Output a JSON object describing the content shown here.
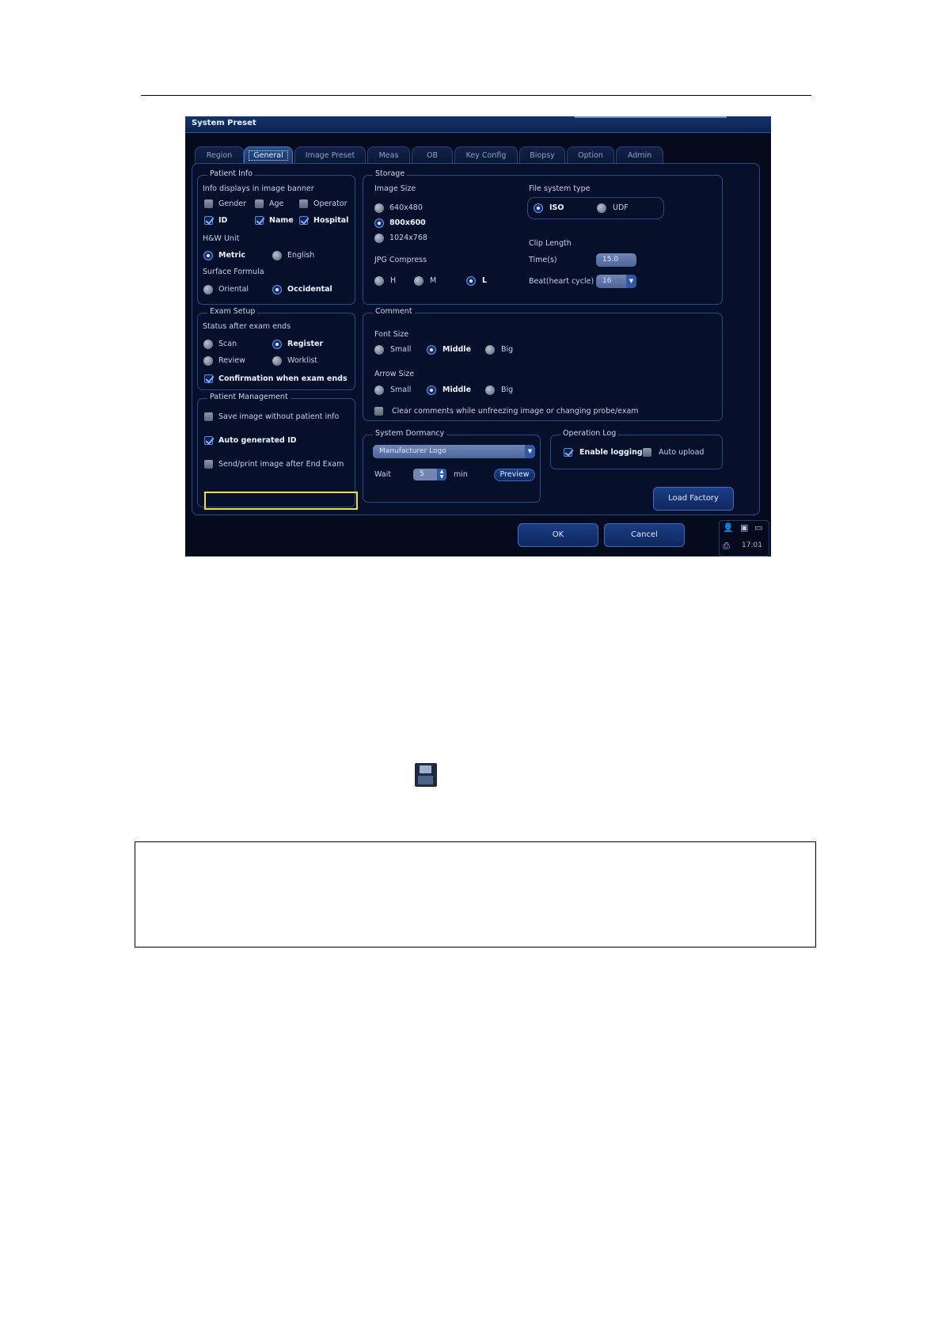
{
  "window": {
    "title": "System Preset"
  },
  "tabs": [
    "Region",
    "General",
    "Image Preset",
    "Meas",
    "OB",
    "Key Config",
    "Biopsy",
    "Option",
    "Admin"
  ],
  "active_tab": "General",
  "patient_info": {
    "legend": "Patient Info",
    "banner_label": "Info displays in image banner",
    "gender": "Gender",
    "age": "Age",
    "operator": "Operator",
    "id": "ID",
    "name": "Name",
    "hospital": "Hospital",
    "hw_unit_label": "H&W Unit",
    "metric": "Metric",
    "english": "English",
    "surface_formula_label": "Surface Formula",
    "oriental": "Oriental",
    "occidental": "Occidental"
  },
  "exam_setup": {
    "legend": "Exam Setup",
    "status_label": "Status after exam ends",
    "scan": "Scan",
    "register": "Register",
    "review": "Review",
    "worklist": "Worklist",
    "confirmation": "Confirmation when exam ends"
  },
  "patient_management": {
    "legend": "Patient Management",
    "save_image": "Save image without patient info",
    "auto_id": "Auto generated ID",
    "send_print": "Send/print image after End Exam"
  },
  "storage": {
    "legend": "Storage",
    "image_size_label": "Image Size",
    "size_640": "640x480",
    "size_800": "800x600",
    "size_1024": "1024x768",
    "jpg_label": "JPG Compress",
    "jpg_h": "H",
    "jpg_m": "M",
    "jpg_l": "L",
    "fs_label": "File system type",
    "fs_iso": "ISO",
    "fs_udf": "UDF",
    "clip_label": "Clip Length",
    "time_label": "Time(s)",
    "time_value": "15.0",
    "beat_label": "Beat(heart cycle)",
    "beat_value": "16"
  },
  "comment": {
    "legend": "Comment",
    "font_size_label": "Font Size",
    "arrow_size_label": "Arrow Size",
    "small": "Small",
    "middle": "Middle",
    "big": "Big",
    "clear_comments": "Clear comments while unfreezing image or changing probe/exam"
  },
  "system_dormancy": {
    "legend": "System Dormancy",
    "mode_value": "Manufacturer Logo",
    "wait_label": "Wait",
    "wait_value": "5",
    "min_label": "min",
    "preview": "Preview"
  },
  "operation_log": {
    "legend": "Operation Log",
    "enable_logging": "Enable logging",
    "auto_upload": "Auto upload"
  },
  "buttons": {
    "load_factory": "Load Factory",
    "ok": "OK",
    "cancel": "Cancel"
  },
  "status_bar": {
    "time": "17:01"
  }
}
